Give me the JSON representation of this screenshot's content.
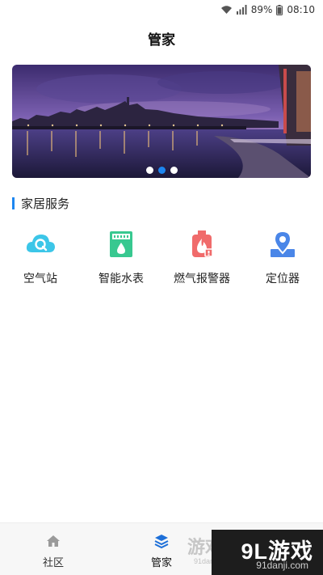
{
  "status_bar": {
    "battery": "89%",
    "time": "08:10",
    "icons": [
      "wifi-icon",
      "signal-icon",
      "battery-icon"
    ]
  },
  "header": {
    "title": "管家"
  },
  "banner": {
    "slide_count": 3,
    "active_index": 1
  },
  "section": {
    "title": "家居服务"
  },
  "services": [
    {
      "label": "空气站",
      "icon": "air-station-icon"
    },
    {
      "label": "智能水表",
      "icon": "water-meter-icon"
    },
    {
      "label": "燃气报警器",
      "icon": "gas-alarm-icon"
    },
    {
      "label": "定位器",
      "icon": "locator-icon"
    }
  ],
  "tab_bar": {
    "tabs": [
      {
        "label": "社区",
        "icon": "home-icon",
        "active": false
      },
      {
        "label": "管家",
        "icon": "butler-icon",
        "active": true
      }
    ]
  },
  "watermark": {
    "text": "9L游戏",
    "url": "91danji.com",
    "faint_text": "游戏",
    "faint_url": "91danji.com"
  },
  "colors": {
    "accent": "#1d86f0",
    "tab_bar_bg": "#f7f7f7"
  }
}
